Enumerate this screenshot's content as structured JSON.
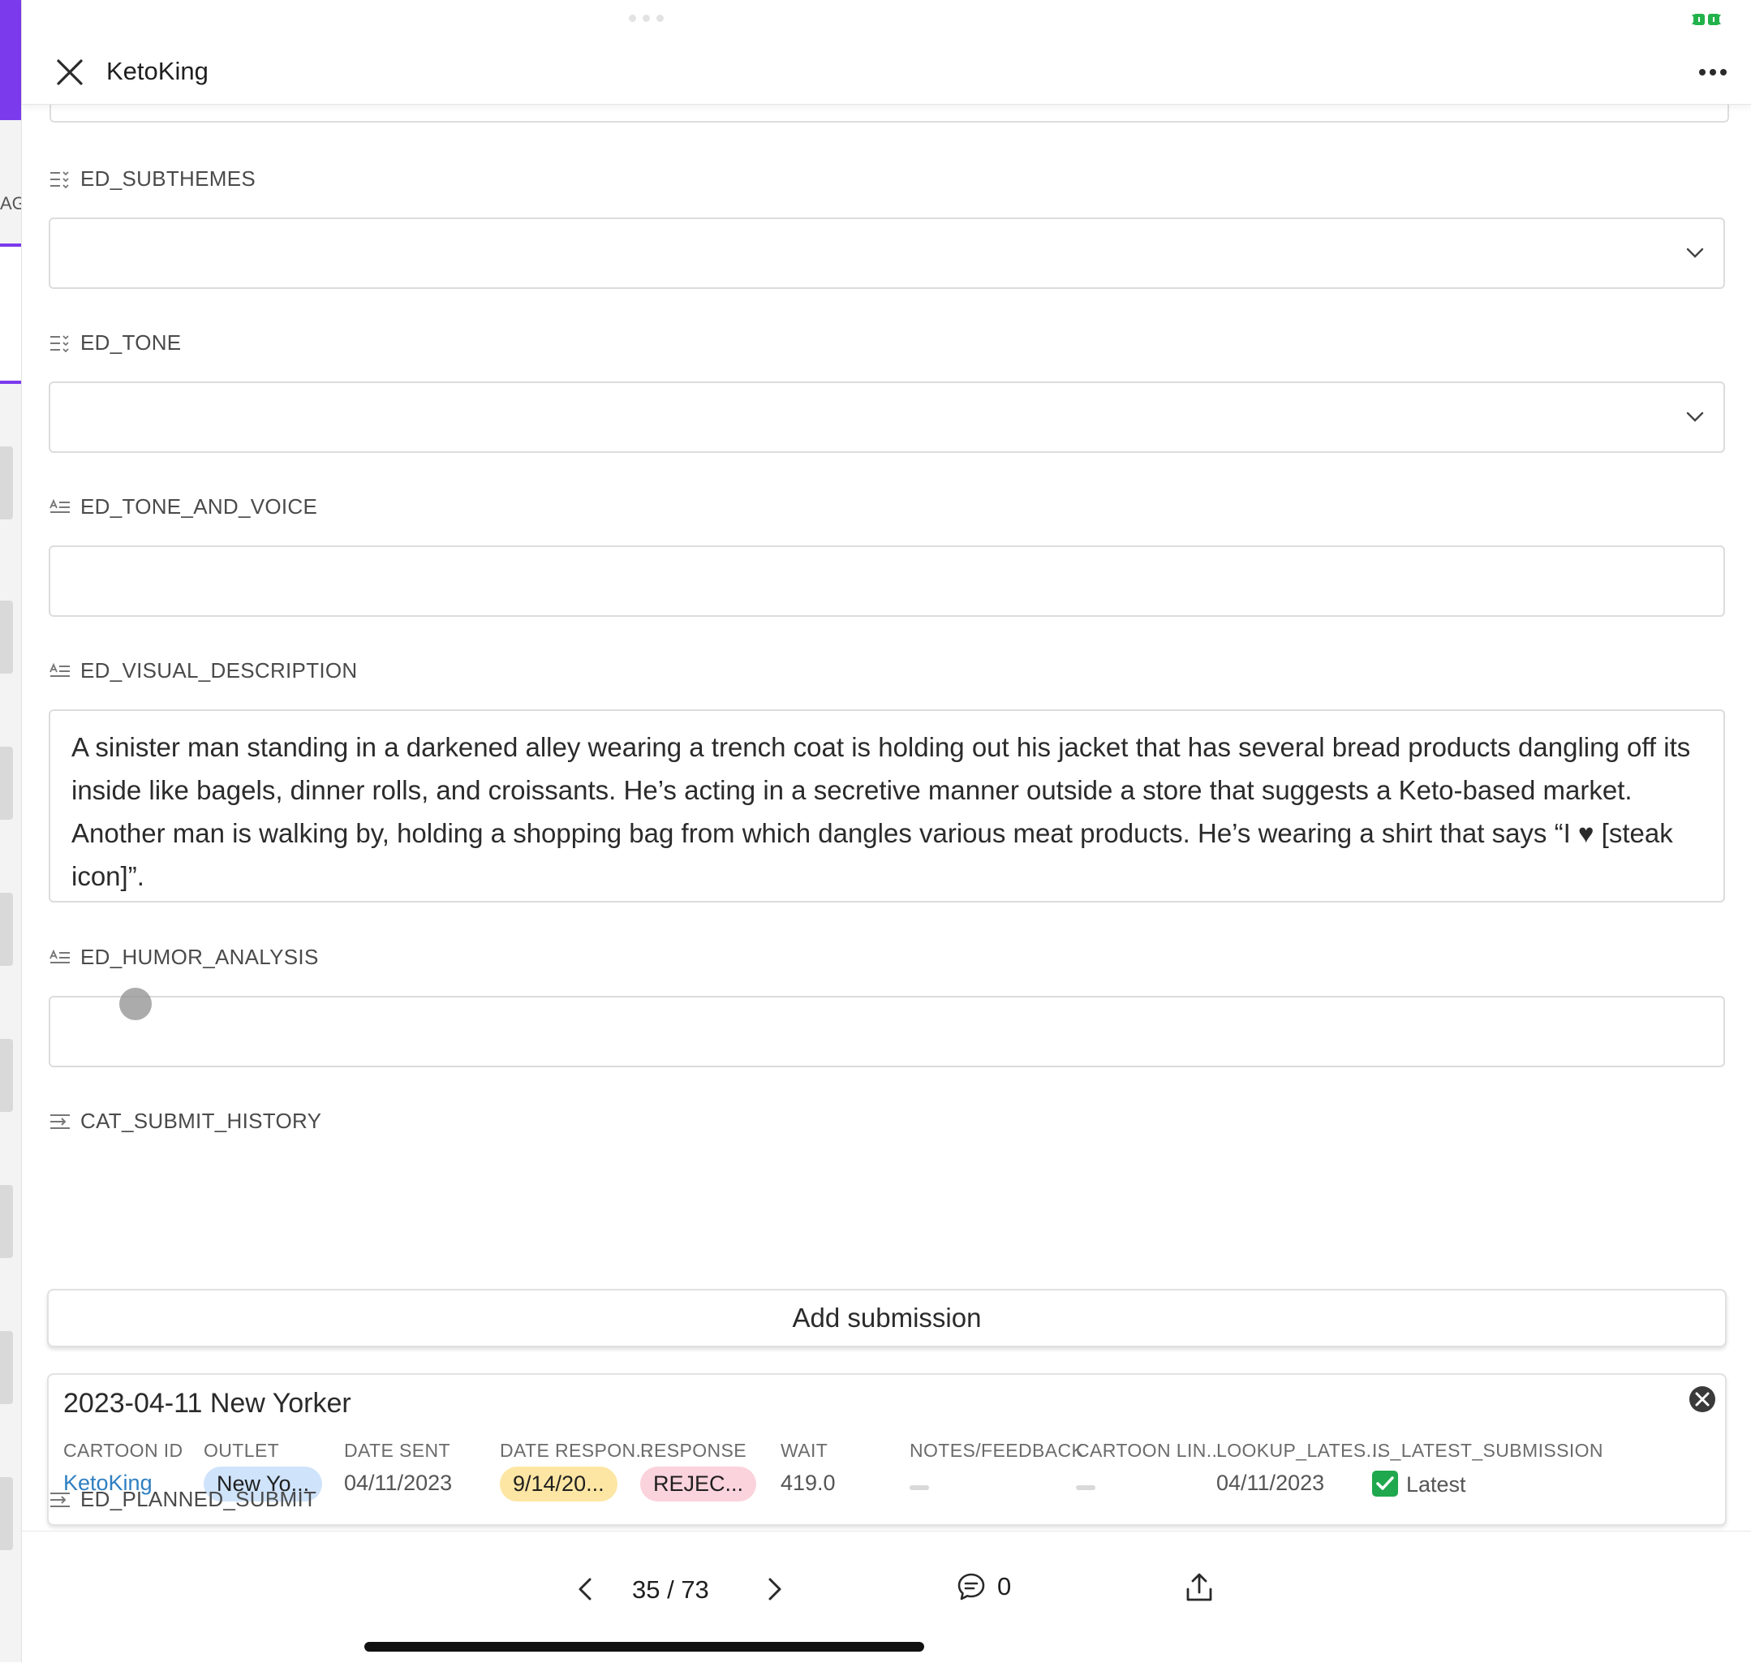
{
  "header": {
    "title": "KetoKing"
  },
  "background": {
    "partial_text": "AG"
  },
  "fields": {
    "subthemes": {
      "label": "ED_SUBTHEMES",
      "value": ""
    },
    "tone": {
      "label": "ED_TONE",
      "value": ""
    },
    "tone_and_voice": {
      "label": "ED_TONE_AND_VOICE",
      "value": ""
    },
    "visual_description": {
      "label": "ED_VISUAL_DESCRIPTION",
      "value": "A sinister man standing in a darkened alley wearing a trench coat is holding out his jacket that has several bread products dangling off its inside like bagels, dinner rolls, and croissants. He’s acting in a secretive manner outside a store that suggests a Keto-based market. Another man is walking by, holding a shopping bag from which dangles various meat products. He’s wearing a shirt that says “I ♥ [steak icon]”."
    },
    "humor_analysis": {
      "label": "ED_HUMOR_ANALYSIS",
      "value": ""
    },
    "submit_history": {
      "label": "CAT_SUBMIT_HISTORY",
      "add_button": "Add submission",
      "record": {
        "title": "2023-04-11 New Yorker",
        "columns": {
          "cartoon_id": {
            "header": "CARTOON ID",
            "value": "KetoKing"
          },
          "outlet": {
            "header": "OUTLET",
            "value": "New Yo..."
          },
          "date_sent": {
            "header": "DATE SENT",
            "value": "04/11/2023"
          },
          "date_responded": {
            "header": "DATE RESPON...",
            "value": "9/14/20..."
          },
          "response": {
            "header": "RESPONSE",
            "value": "REJEC..."
          },
          "wait": {
            "header": "WAIT",
            "value": "419.0"
          },
          "notes": {
            "header": "NOTES/FEEDBACK",
            "value": ""
          },
          "cartoon_link": {
            "header": "CARTOON LIN...",
            "value": ""
          },
          "lookup_latest": {
            "header": "LOOKUP_LATES...",
            "value": "04/11/2023"
          },
          "is_latest": {
            "header": "IS_LATEST_SUBMISSION",
            "value": "Latest"
          }
        }
      }
    },
    "planned_submit": {
      "label": "ED_PLANNED_SUBMIT"
    }
  },
  "footer": {
    "page_indicator": "35 / 73",
    "comment_count": "0"
  },
  "colors": {
    "accent_purple": "#7c3aed",
    "link_blue": "#2f7fc1",
    "pill_blue": "#cfe3fb",
    "pill_yellow": "#fde6a3",
    "pill_pink": "#fbd3dc",
    "check_green": "#1fa84d"
  },
  "icons": {
    "close": "close-icon",
    "more": "more-horizontal-icon",
    "multi_select": "multi-select-field-icon",
    "long_text": "long-text-field-icon",
    "linked_record": "linked-record-field-icon",
    "chevron": "chevron-down-icon",
    "remove": "remove-record-icon",
    "prev": "chevron-left-icon",
    "next": "chevron-right-icon",
    "comment": "comment-icon",
    "share": "share-icon"
  }
}
